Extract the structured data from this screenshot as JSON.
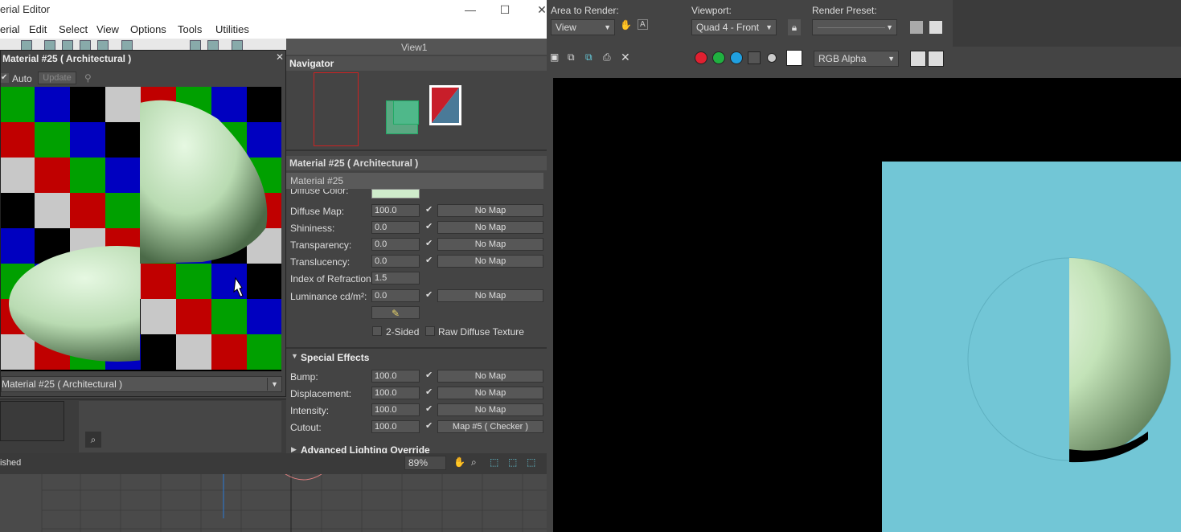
{
  "material_editor": {
    "title": "erial Editor",
    "menu": [
      "erial",
      "Edit",
      "Select",
      "View",
      "Options",
      "Tools",
      "Utilities"
    ],
    "window_buttons": {
      "minimize": "—",
      "maximize": "☐",
      "close": "✕"
    }
  },
  "sample_panel": {
    "title": "Material #25  ( Architectural )",
    "auto_label": "Auto",
    "update_label": "Update",
    "dropdown_value": "Material #25  ( Architectural )"
  },
  "view_tab": "View1",
  "navigator": {
    "title": "Navigator"
  },
  "params": {
    "header": "Material #25  ( Architectural )",
    "name": "Material #25",
    "diffuse_color_label": "Diffuse Color:",
    "rows": [
      {
        "label": "Diffuse Map:",
        "value": "100.0",
        "map": "No Map"
      },
      {
        "label": "Shininess:",
        "value": "0.0",
        "map": "No Map"
      },
      {
        "label": "Transparency:",
        "value": "0.0",
        "map": "No Map"
      },
      {
        "label": "Translucency:",
        "value": "0.0",
        "map": "No Map"
      },
      {
        "label": "Index of Refraction:",
        "value": "1.5",
        "map": ""
      },
      {
        "label": "Luminance cd/m²:",
        "value": "0.0",
        "map": "No Map"
      }
    ],
    "two_sided": "2-Sided",
    "raw_diffuse": "Raw Diffuse Texture"
  },
  "special_effects": {
    "title": "Special Effects",
    "rows": [
      {
        "label": "Bump:",
        "value": "100.0",
        "map": "No Map"
      },
      {
        "label": "Displacement:",
        "value": "100.0",
        "map": "No Map"
      },
      {
        "label": "Intensity:",
        "value": "100.0",
        "map": "No Map"
      },
      {
        "label": "Cutout:",
        "value": "100.0",
        "map": "Map #5  ( Checker )"
      }
    ]
  },
  "advanced_title": "Advanced Lighting Override",
  "status": {
    "text": "ished",
    "zoom": "89%"
  },
  "render": {
    "area_label": "Area to Render:",
    "area_value": "View",
    "viewport_label": "Viewport:",
    "viewport_value": "Quad 4 - Front",
    "preset_label": "Render Preset:",
    "preset_value": "",
    "channel_value": "RGB Alpha"
  },
  "colors": {
    "sphere": "#cfeccb",
    "render_bg": "#72c6d6",
    "checker": [
      "#00a000",
      "#0000c0",
      "#000000",
      "#c8c8c8",
      "#c00000"
    ]
  }
}
